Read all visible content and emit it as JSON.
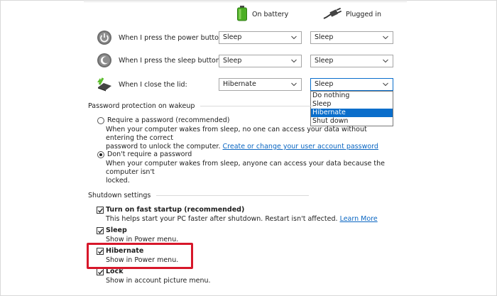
{
  "columns": {
    "battery_label": "On battery",
    "plugged_label": "Plugged in"
  },
  "rows": [
    {
      "label": "When I press the power button:",
      "battery": "Sleep",
      "plugged": "Sleep",
      "icon": "power-button-icon"
    },
    {
      "label": "When I press the sleep button:",
      "battery": "Sleep",
      "plugged": "Sleep",
      "icon": "sleep-button-icon"
    },
    {
      "label": "When I close the lid:",
      "battery": "Hibernate",
      "plugged": "Sleep",
      "icon": "laptop-lid-icon"
    }
  ],
  "dropdown": {
    "options": [
      "Do nothing",
      "Sleep",
      "Hibernate",
      "Shut down"
    ],
    "highlighted": "Hibernate"
  },
  "password": {
    "title": "Password protection on wakeup",
    "require_label": "Require a password (recommended)",
    "require_desc_line1": "When your computer wakes from sleep, no one can access your data without entering the correct",
    "require_desc_line2_prefix": "password to unlock the computer.",
    "require_link": "Create or change your user account password",
    "no_require_label": "Don't require a password",
    "no_require_desc_line1": "When your computer wakes from sleep, anyone can access your data because the computer isn't",
    "no_require_desc_line2": "locked.",
    "selected": "dont_require"
  },
  "shutdown": {
    "title": "Shutdown settings",
    "items": [
      {
        "label": "Turn on fast startup (recommended)",
        "desc": "This helps start your PC faster after shutdown. Restart isn't affected.",
        "link": "Learn More",
        "checked": true
      },
      {
        "label": "Sleep",
        "desc": "Show in Power menu.",
        "checked": true
      },
      {
        "label": "Hibernate",
        "desc": "Show in Power menu.",
        "checked": true
      },
      {
        "label": "Lock",
        "desc": "Show in account picture menu.",
        "checked": true
      }
    ]
  },
  "colors": {
    "accent": "#0a6ecb",
    "highlight_box": "#d7172a",
    "link": "#0a66c2"
  }
}
